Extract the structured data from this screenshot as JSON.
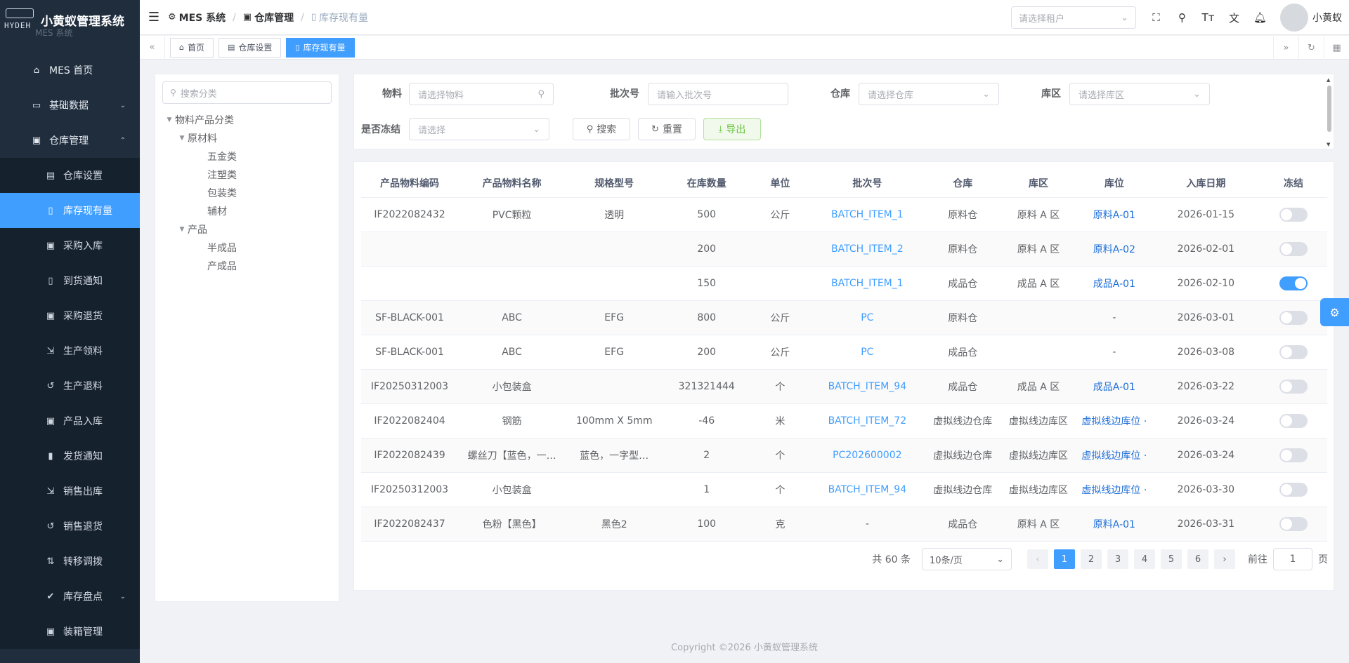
{
  "app": {
    "title": "小黄蚁管理系统",
    "logo_text": "HYDEH",
    "subtitle": "MES 系统"
  },
  "sidebar": {
    "items": [
      {
        "label": "MES 首页",
        "icon": "home-icon",
        "glyph": "⌂",
        "sub": false
      },
      {
        "label": "基础数据",
        "icon": "monitor-icon",
        "glyph": "▭",
        "sub": false,
        "arrow": "⌄"
      },
      {
        "label": "仓库管理",
        "icon": "warehouse-icon",
        "glyph": "▣",
        "sub": false,
        "arrow": "⌃"
      },
      {
        "label": "仓库设置",
        "icon": "building-icon",
        "glyph": "▤",
        "sub": true
      },
      {
        "label": "库存现有量",
        "icon": "document-icon",
        "glyph": "▯",
        "sub": true,
        "active": true
      },
      {
        "label": "采购入库",
        "icon": "box-icon",
        "glyph": "▣",
        "sub": true
      },
      {
        "label": "到货通知",
        "icon": "notice-icon",
        "glyph": "▯",
        "sub": true
      },
      {
        "label": "采购退货",
        "icon": "box-return-icon",
        "glyph": "▣",
        "sub": true
      },
      {
        "label": "生产领料",
        "icon": "pick-icon",
        "glyph": "⇲",
        "sub": true
      },
      {
        "label": "生产退料",
        "icon": "refresh-icon",
        "glyph": "↺",
        "sub": true
      },
      {
        "label": "产品入库",
        "icon": "product-in-icon",
        "glyph": "▣",
        "sub": true
      },
      {
        "label": "发货通知",
        "icon": "clipboard-icon",
        "glyph": "▮",
        "sub": true
      },
      {
        "label": "销售出库",
        "icon": "sale-out-icon",
        "glyph": "⇲",
        "sub": true
      },
      {
        "label": "销售退货",
        "icon": "undo-icon",
        "glyph": "↺",
        "sub": true
      },
      {
        "label": "转移调拨",
        "icon": "transfer-icon",
        "glyph": "⇅",
        "sub": true
      },
      {
        "label": "库存盘点",
        "icon": "check-circle-icon",
        "glyph": "✔",
        "sub": true,
        "arrow": "⌄"
      },
      {
        "label": "装箱管理",
        "icon": "package-icon",
        "glyph": "▣",
        "sub": true
      }
    ]
  },
  "navbar": {
    "breadcrumb": [
      {
        "label": "MES 系统",
        "glyph": "⚙"
      },
      {
        "label": "仓库管理",
        "glyph": "▣"
      },
      {
        "label": "库存现有量",
        "glyph": "▯"
      }
    ],
    "tenant_placeholder": "请选择租户",
    "username": "小黄蚁"
  },
  "tags": [
    {
      "label": "首页",
      "glyph": "⌂"
    },
    {
      "label": "仓库设置",
      "glyph": "▤"
    },
    {
      "label": "库存现有量",
      "glyph": "▯",
      "active": true
    }
  ],
  "tree": {
    "search_placeholder": "搜索分类",
    "nodes": [
      {
        "label": "物料产品分类",
        "level": 0,
        "expanded": true
      },
      {
        "label": "原材料",
        "level": 1,
        "expanded": true
      },
      {
        "label": "五金类",
        "level": 2
      },
      {
        "label": "注塑类",
        "level": 2
      },
      {
        "label": "包装类",
        "level": 2
      },
      {
        "label": "辅材",
        "level": 2
      },
      {
        "label": "产品",
        "level": 1,
        "expanded": true
      },
      {
        "label": "半成品",
        "level": 2
      },
      {
        "label": "产成品",
        "level": 2
      }
    ]
  },
  "filter": {
    "material_label": "物料",
    "material_placeholder": "请选择物料",
    "batch_label": "批次号",
    "batch_placeholder": "请输入批次号",
    "warehouse_label": "仓库",
    "warehouse_placeholder": "请选择仓库",
    "area_label": "库区",
    "area_placeholder": "请选择库区",
    "frozen_label": "是否冻结",
    "frozen_placeholder": "请选择",
    "search_btn": "搜索",
    "reset_btn": "重置",
    "export_btn": "导出"
  },
  "table": {
    "columns": [
      "产品物料编码",
      "产品物料名称",
      "规格型号",
      "在库数量",
      "单位",
      "批次号",
      "仓库",
      "库区",
      "库位",
      "入库日期",
      "冻结"
    ],
    "rows": [
      {
        "code": "IF2022082432",
        "name": "PVC颗粒",
        "spec": "透明",
        "qty": "500",
        "unit": "公斤",
        "batch": "BATCH_ITEM_1",
        "warehouse": "原料仓",
        "area": "原料 A 区",
        "loc": "原料A-01",
        "date": "2026-01-15",
        "frozen": false
      },
      {
        "code": "",
        "name": "",
        "spec": "",
        "qty": "200",
        "unit": "",
        "batch": "BATCH_ITEM_2",
        "warehouse": "原料仓",
        "area": "原料 A 区",
        "loc": "原料A-02",
        "date": "2026-02-01",
        "frozen": false
      },
      {
        "code": "",
        "name": "",
        "spec": "",
        "qty": "150",
        "unit": "",
        "batch": "BATCH_ITEM_1",
        "warehouse": "成品仓",
        "area": "成品 A 区",
        "loc": "成品A-01",
        "date": "2026-02-10",
        "frozen": true
      },
      {
        "code": "SF-BLACK-001",
        "name": "ABC",
        "spec": "EFG",
        "qty": "800",
        "unit": "公斤",
        "batch": "PC",
        "warehouse": "原料仓",
        "area": "",
        "loc": "-",
        "date": "2026-03-01",
        "frozen": false
      },
      {
        "code": "SF-BLACK-001",
        "name": "ABC",
        "spec": "EFG",
        "qty": "200",
        "unit": "公斤",
        "batch": "PC",
        "warehouse": "成品仓",
        "area": "",
        "loc": "-",
        "date": "2026-03-08",
        "frozen": false
      },
      {
        "code": "IF20250312003",
        "name": "小包装盒",
        "spec": "",
        "qty": "321321444",
        "unit": "个",
        "batch": "BATCH_ITEM_94",
        "warehouse": "成品仓",
        "area": "成品 A 区",
        "loc": "成品A-01",
        "date": "2026-03-22",
        "frozen": false
      },
      {
        "code": "IF2022082404",
        "name": "钢筋",
        "spec": "100mm X 5mm",
        "qty": "-46",
        "unit": "米",
        "batch": "BATCH_ITEM_72",
        "warehouse": "虚拟线边仓库",
        "area": "虚拟线边库区",
        "loc": "虚拟线边库位 ·",
        "date": "2026-03-24",
        "frozen": false
      },
      {
        "code": "IF2022082439",
        "name": "螺丝刀【蓝色，一…",
        "spec": "蓝色，一字型…",
        "qty": "2",
        "unit": "个",
        "batch": "PC202600002",
        "warehouse": "虚拟线边仓库",
        "area": "虚拟线边库区",
        "loc": "虚拟线边库位 ·",
        "date": "2026-03-24",
        "frozen": false
      },
      {
        "code": "IF20250312003",
        "name": "小包装盒",
        "spec": "",
        "qty": "1",
        "unit": "个",
        "batch": "BATCH_ITEM_94",
        "warehouse": "虚拟线边仓库",
        "area": "虚拟线边库区",
        "loc": "虚拟线边库位 ·",
        "date": "2026-03-30",
        "frozen": false
      },
      {
        "code": "IF2022082437",
        "name": "色粉【黑色】",
        "spec": "黑色2",
        "qty": "100",
        "unit": "克",
        "batch": "-",
        "warehouse": "成品仓",
        "area": "原料 A 区",
        "loc": "原料A-01",
        "date": "2026-03-31",
        "frozen": false
      }
    ]
  },
  "pagination": {
    "total": "共 60 条",
    "page_size": "10条/页",
    "pages": [
      "1",
      "2",
      "3",
      "4",
      "5",
      "6"
    ],
    "current": "1",
    "goto_label": "前往",
    "goto_value": "1",
    "page_suffix": "页"
  },
  "footer": {
    "copyright": "Copyright ©2026 小黄蚁管理系统"
  }
}
